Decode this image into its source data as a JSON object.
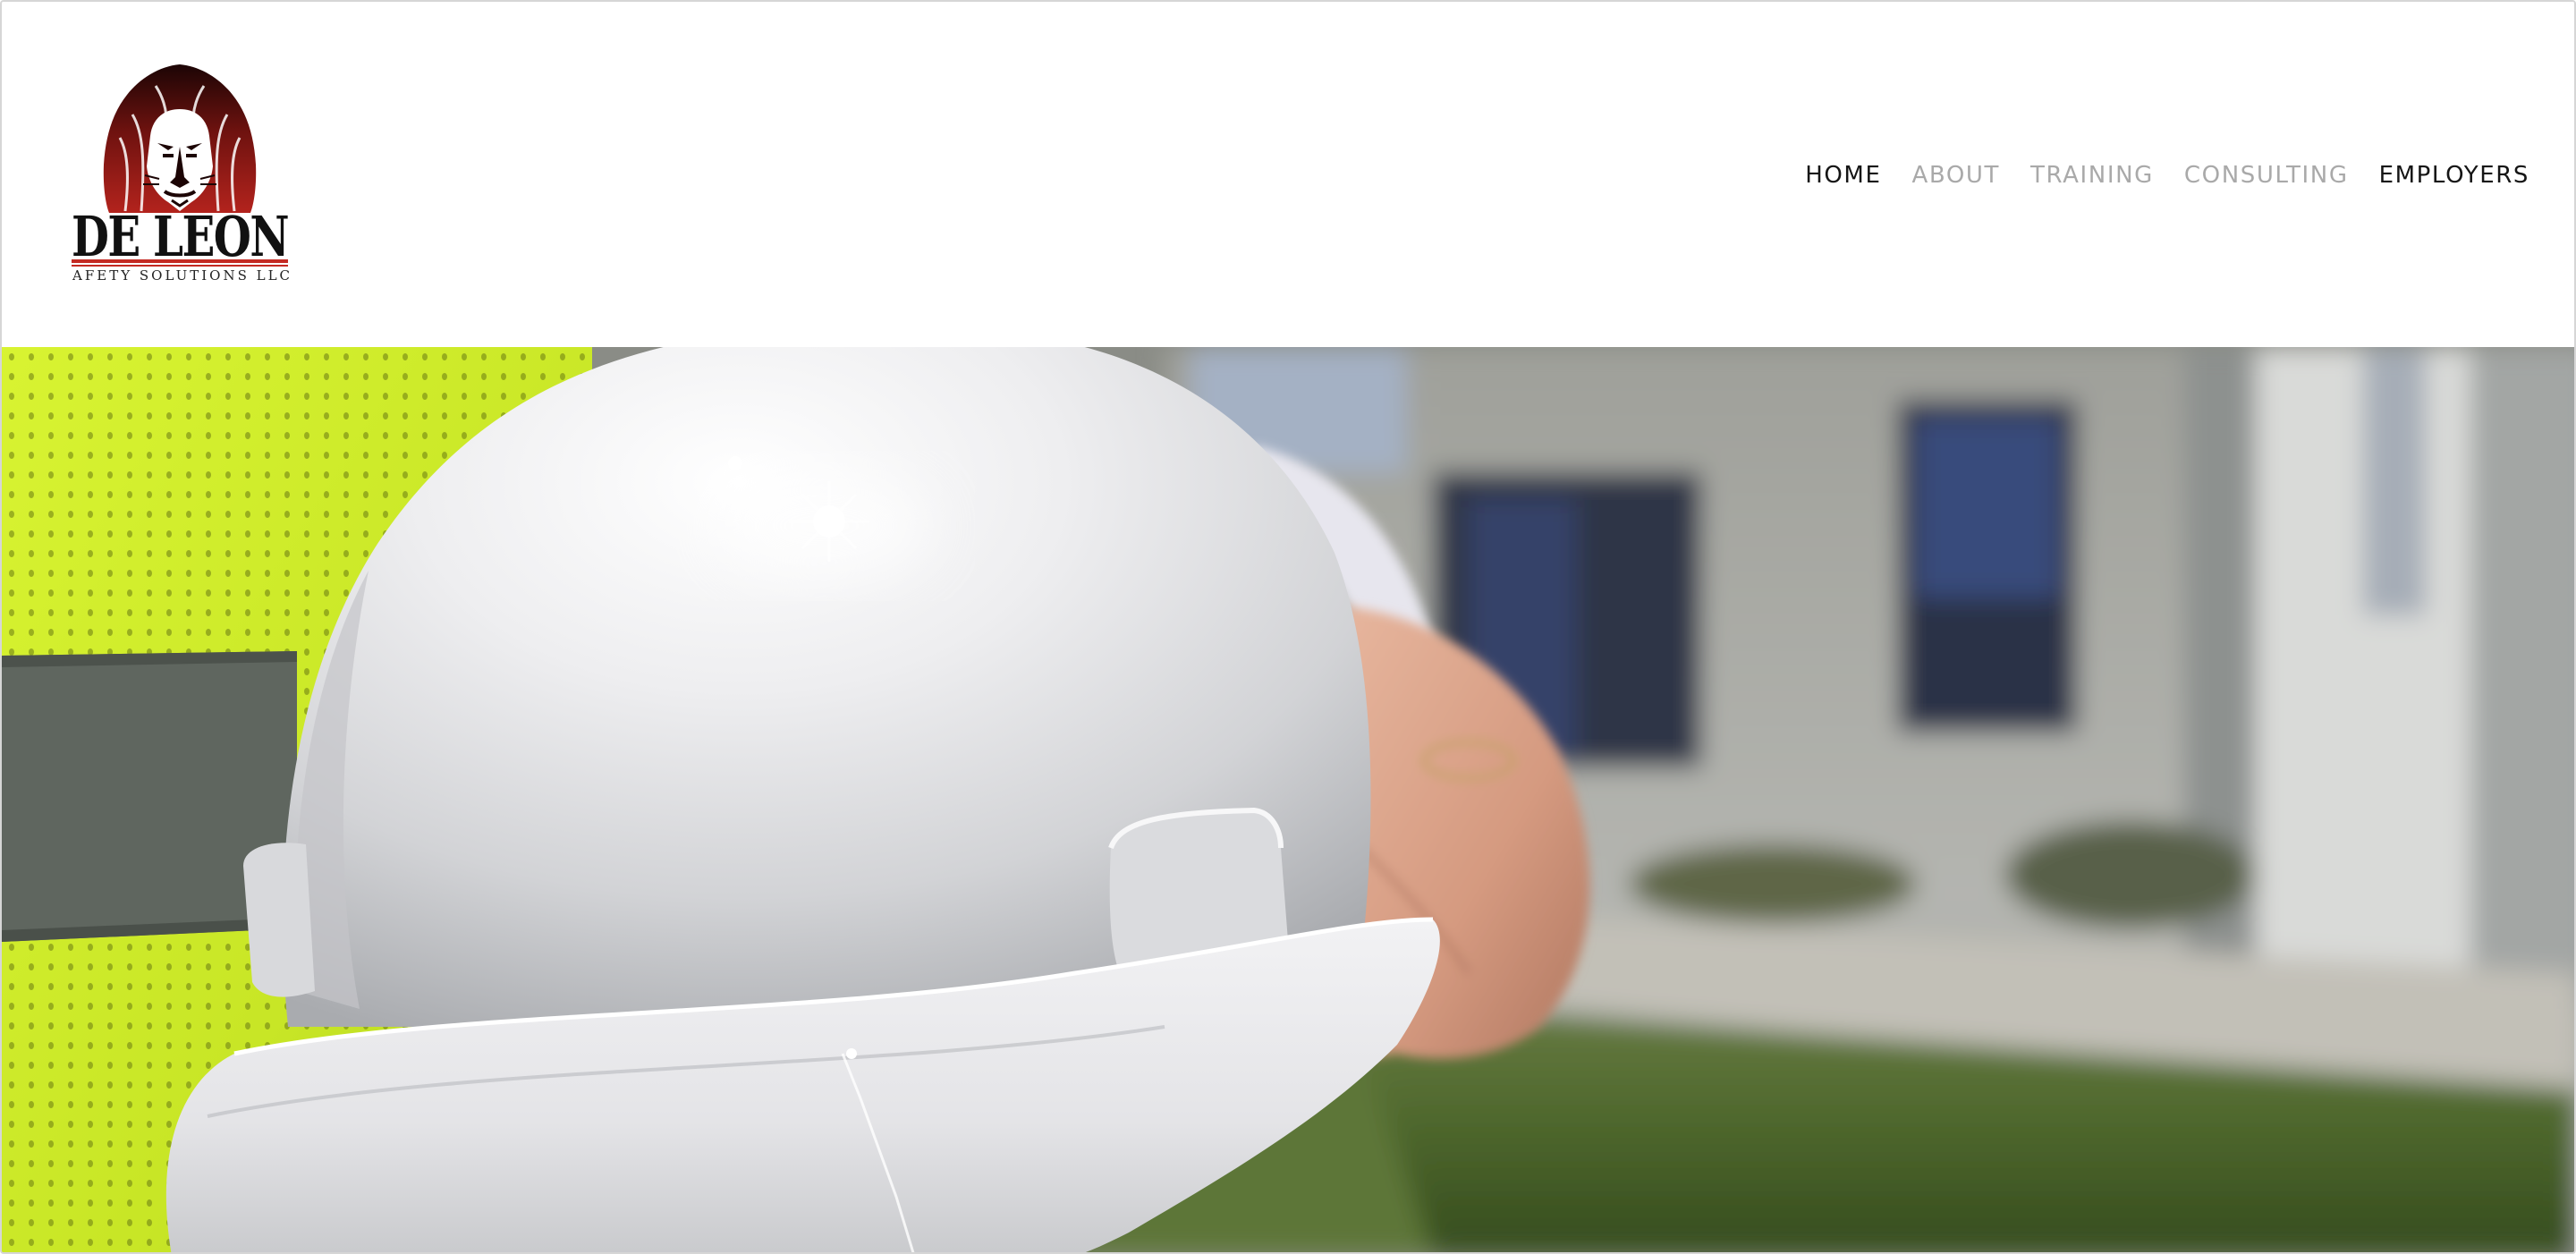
{
  "brand": {
    "logo_icon": "lion-head-icon",
    "name_line1": "DE LEON",
    "name_line2": "SAFETY SOLUTIONS LLC.",
    "logo_colors": {
      "dark": "#1c0505",
      "red": "#a51f1b",
      "accent_rule": "#c42a23"
    }
  },
  "nav": {
    "items": [
      {
        "label": "HOME",
        "state": "active"
      },
      {
        "label": "ABOUT",
        "state": "muted"
      },
      {
        "label": "TRAINING",
        "state": "muted"
      },
      {
        "label": "CONSULTING",
        "state": "muted"
      },
      {
        "label": "EMPLOYERS",
        "state": "active"
      }
    ],
    "colors": {
      "active": "#151515",
      "muted": "#a9a9a9"
    }
  },
  "hero": {
    "image_subject": "hard-hat-image",
    "colors": {
      "vest_yellow": "#d4f02c",
      "reflective_stripe": "#5f665f",
      "helmet_white": "#ededef",
      "building": "#b9bab5",
      "lawn": "#4c6b2c"
    }
  }
}
